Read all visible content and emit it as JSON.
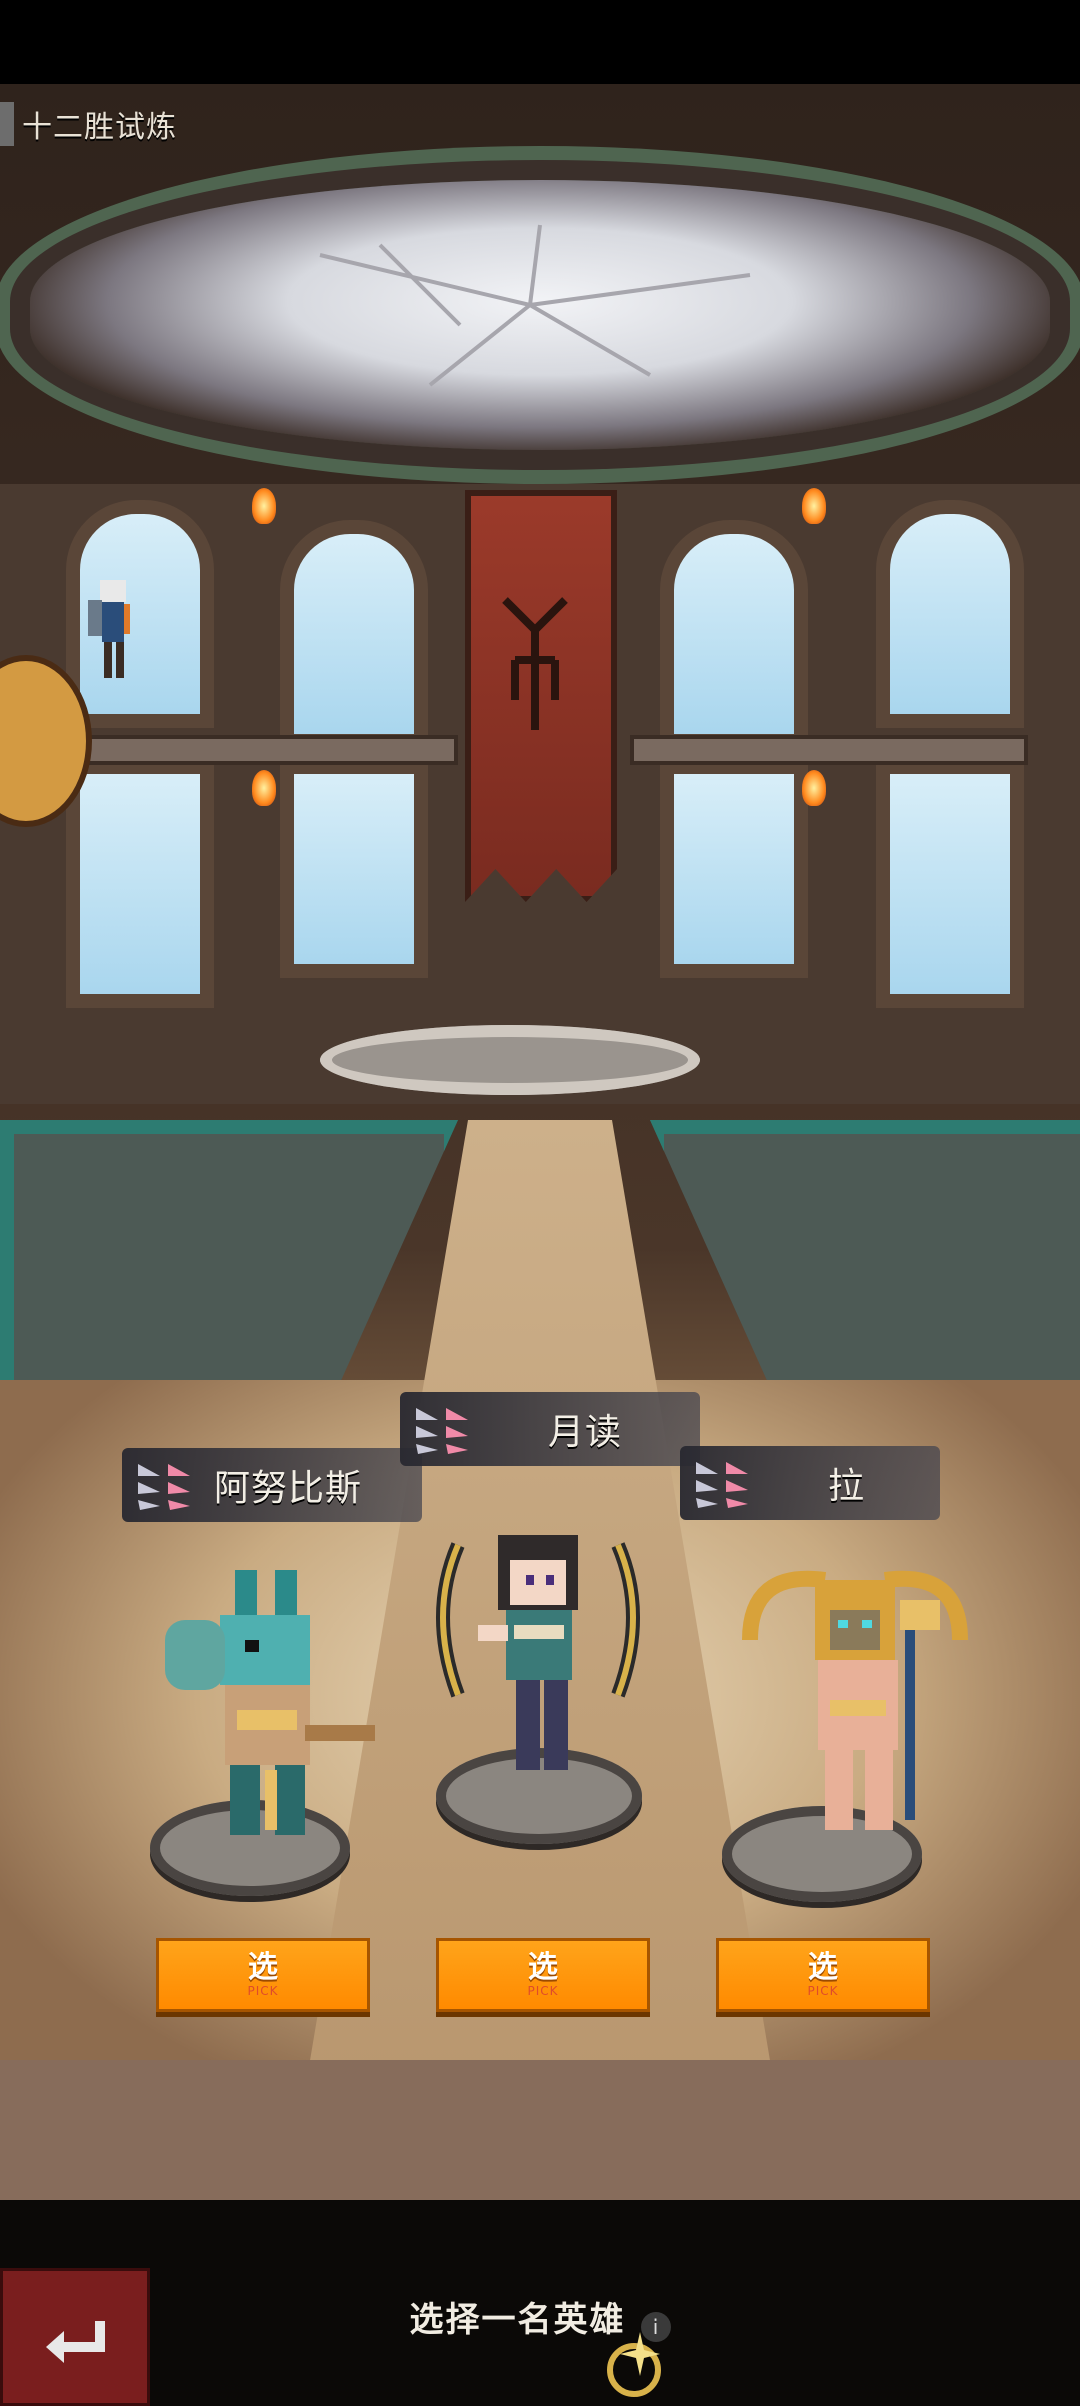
{
  "screen": {
    "title": "十二胜试炼"
  },
  "heroes": [
    {
      "name": "阿努比斯",
      "pick_label": "选",
      "pick_sub": "PICK",
      "rank_icon": "rank-wings-icon"
    },
    {
      "name": "月读",
      "pick_label": "选",
      "pick_sub": "PICK",
      "rank_icon": "rank-wings-icon"
    },
    {
      "name": "拉",
      "pick_label": "选",
      "pick_sub": "PICK",
      "rank_icon": "rank-wings-icon"
    }
  ],
  "footer": {
    "prompt": "选择一名英雄",
    "info_glyph": "i",
    "back_icon": "return-arrow-icon"
  },
  "colors": {
    "pick_button": "#ff8a00",
    "back_button": "#7a1e1e",
    "name_tag": "#2d2d36"
  }
}
